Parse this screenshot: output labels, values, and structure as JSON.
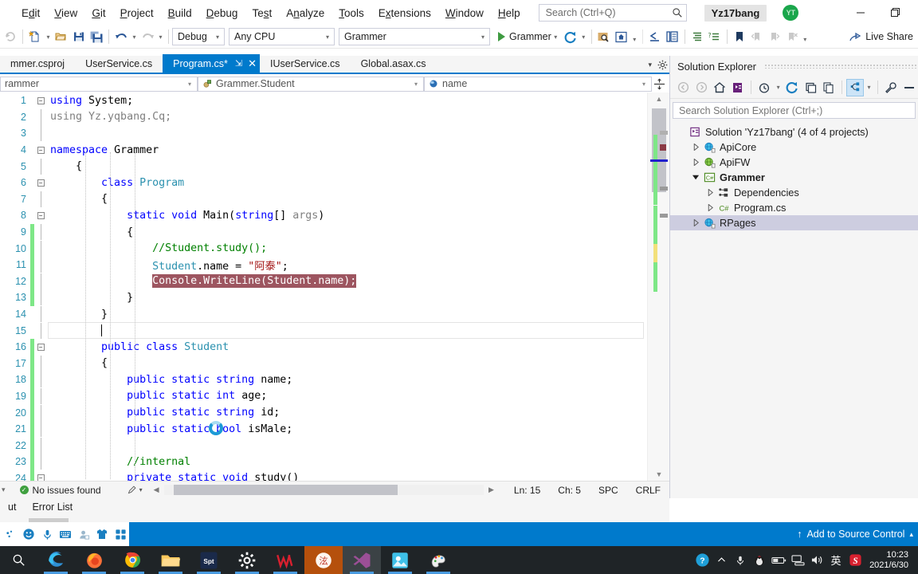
{
  "menubar": {
    "items": [
      {
        "label": "Edit",
        "accel": "d"
      },
      {
        "label": "View",
        "accel": "V"
      },
      {
        "label": "Git",
        "accel": "G"
      },
      {
        "label": "Project",
        "accel": "P"
      },
      {
        "label": "Build",
        "accel": "B"
      },
      {
        "label": "Debug",
        "accel": "D"
      },
      {
        "label": "Test",
        "accel": "s"
      },
      {
        "label": "Analyze",
        "accel": "n"
      },
      {
        "label": "Tools",
        "accel": "T"
      },
      {
        "label": "Extensions",
        "accel": "x"
      },
      {
        "label": "Window",
        "accel": "W"
      },
      {
        "label": "Help",
        "accel": "H"
      }
    ],
    "search_placeholder": "Search (Ctrl+Q)",
    "account_name": "Yz17bang",
    "avatar_initials": "YT",
    "minimize_label": "Minimize",
    "restore_label": "Restore"
  },
  "toolbar": {
    "config_combo": "Debug",
    "platform_combo": "Any CPU",
    "startup_combo": "Grammer",
    "run_label": "Grammer",
    "live_share_label": "Live Share",
    "icons": [
      "navigate-back-icon",
      "new-file-icon",
      "open-file-icon",
      "save-icon",
      "save-all-icon",
      "undo-icon",
      "redo-icon"
    ]
  },
  "tabs": {
    "items": [
      {
        "label": "mmer.csproj",
        "active": false
      },
      {
        "label": "UserService.cs",
        "active": false
      },
      {
        "label": "Program.cs*",
        "active": true
      },
      {
        "label": "IUserService.cs",
        "active": false
      },
      {
        "label": "Global.asax.cs",
        "active": false
      }
    ],
    "pin_glyph": "⇲",
    "close_glyph": "✕"
  },
  "navbar": {
    "project_combo": "rammer",
    "type_combo": "Grammer.Student",
    "member_combo": "name"
  },
  "editor": {
    "lines": [
      {
        "n": 1,
        "fold": "minus",
        "change": "",
        "indent": 0,
        "tokens": [
          {
            "t": "using ",
            "c": "k"
          },
          {
            "t": "System;",
            "c": "pl"
          }
        ]
      },
      {
        "n": 2,
        "fold": "",
        "change": "",
        "indent": 0,
        "tokens": [
          {
            "t": "using Yz.yqbang.Cq;",
            "c": "gy"
          }
        ]
      },
      {
        "n": 3,
        "fold": "",
        "change": "",
        "indent": 0,
        "tokens": []
      },
      {
        "n": 4,
        "fold": "minus",
        "change": "",
        "indent": 0,
        "tokens": [
          {
            "t": "namespace ",
            "c": "k"
          },
          {
            "t": "Grammer",
            "c": "pl"
          }
        ]
      },
      {
        "n": 5,
        "fold": "",
        "change": "",
        "indent": 1,
        "tokens": [
          {
            "t": "{",
            "c": "pl"
          }
        ]
      },
      {
        "n": 6,
        "fold": "minus",
        "change": "",
        "indent": 2,
        "tokens": [
          {
            "t": "class ",
            "c": "k"
          },
          {
            "t": "Program",
            "c": "ty"
          }
        ]
      },
      {
        "n": 7,
        "fold": "",
        "change": "",
        "indent": 2,
        "tokens": [
          {
            "t": "{",
            "c": "pl"
          }
        ]
      },
      {
        "n": 8,
        "fold": "minus",
        "change": "",
        "indent": 3,
        "tokens": [
          {
            "t": "static void ",
            "c": "k"
          },
          {
            "t": "Main(",
            "c": "pl"
          },
          {
            "t": "string",
            "c": "k"
          },
          {
            "t": "[] ",
            "c": "pl"
          },
          {
            "t": "args",
            "c": "pr"
          },
          {
            "t": ")",
            "c": "pl"
          }
        ]
      },
      {
        "n": 9,
        "fold": "",
        "change": "green",
        "indent": 3,
        "tokens": [
          {
            "t": "{",
            "c": "pl"
          }
        ]
      },
      {
        "n": 10,
        "fold": "",
        "change": "green",
        "indent": 4,
        "tokens": [
          {
            "t": "//Student.study();",
            "c": "cm"
          }
        ]
      },
      {
        "n": 11,
        "fold": "",
        "change": "green",
        "indent": 4,
        "tokens": [
          {
            "t": "Student",
            "c": "ty"
          },
          {
            "t": ".name = ",
            "c": "pl"
          },
          {
            "t": "\"阿泰\"",
            "c": "st"
          },
          {
            "t": ";",
            "c": "pl"
          }
        ]
      },
      {
        "n": 12,
        "fold": "",
        "change": "green",
        "indent": 4,
        "selected": true,
        "tokens": [
          {
            "t": "Console.WriteLine(Student.name);",
            "c": "pl"
          }
        ]
      },
      {
        "n": 13,
        "fold": "",
        "change": "green",
        "indent": 3,
        "tokens": [
          {
            "t": "}",
            "c": "pl"
          }
        ]
      },
      {
        "n": 14,
        "fold": "",
        "change": "",
        "indent": 2,
        "tokens": [
          {
            "t": "}",
            "c": "pl"
          }
        ]
      },
      {
        "n": 15,
        "fold": "",
        "change": "",
        "indent": 2,
        "current": true,
        "tokens": []
      },
      {
        "n": 16,
        "fold": "minus",
        "change": "green",
        "indent": 2,
        "tokens": [
          {
            "t": "public class ",
            "c": "k"
          },
          {
            "t": "Student",
            "c": "ty"
          }
        ]
      },
      {
        "n": 17,
        "fold": "",
        "change": "green",
        "indent": 2,
        "tokens": [
          {
            "t": "{",
            "c": "pl"
          }
        ]
      },
      {
        "n": 18,
        "fold": "",
        "change": "green",
        "indent": 3,
        "tokens": [
          {
            "t": "public static string ",
            "c": "k"
          },
          {
            "t": "name;",
            "c": "pl"
          }
        ]
      },
      {
        "n": 19,
        "fold": "",
        "change": "green",
        "indent": 3,
        "tokens": [
          {
            "t": "public static int ",
            "c": "k"
          },
          {
            "t": "age;",
            "c": "pl"
          }
        ]
      },
      {
        "n": 20,
        "fold": "",
        "change": "green",
        "indent": 3,
        "tokens": [
          {
            "t": "public static string ",
            "c": "k"
          },
          {
            "t": "id;",
            "c": "pl"
          }
        ]
      },
      {
        "n": 21,
        "fold": "",
        "change": "green",
        "indent": 3,
        "tokens": [
          {
            "t": "public static bool ",
            "c": "k"
          },
          {
            "t": "isMale;",
            "c": "pl"
          }
        ]
      },
      {
        "n": 22,
        "fold": "",
        "change": "green",
        "indent": 3,
        "tokens": []
      },
      {
        "n": 23,
        "fold": "",
        "change": "green",
        "indent": 3,
        "tokens": [
          {
            "t": "//internal",
            "c": "cm"
          }
        ]
      },
      {
        "n": 24,
        "fold": "minus",
        "change": "green",
        "indent": 3,
        "tokens": [
          {
            "t": "private static void ",
            "c": "k"
          },
          {
            "t": "study()",
            "c": "pl"
          }
        ]
      }
    ]
  },
  "editor_status": {
    "issues": "No issues found",
    "line": "Ln: 15",
    "col": "Ch: 5",
    "spaces": "SPC",
    "eol": "CRLF"
  },
  "solution_explorer": {
    "title": "Solution Explorer",
    "search_placeholder": "Search Solution Explorer (Ctrl+;)",
    "toolbar_icons": [
      "back-icon",
      "forward-icon",
      "home-icon",
      "pending-changes-icon",
      "history-icon",
      "refresh-icon",
      "collapse-all-icon",
      "show-all-files-icon",
      "solution-view-icon",
      "properties-icon",
      "preview-icon"
    ],
    "tree": [
      {
        "label": "Solution 'Yz17bang' (4 of 4 projects)",
        "depth": 0,
        "arrow": "",
        "icon": "solution-icon",
        "bold": false,
        "selected": false
      },
      {
        "label": "ApiCore",
        "depth": 1,
        "arrow": "collapsed",
        "icon": "web-project-icon",
        "bold": false,
        "selected": false
      },
      {
        "label": "ApiFW",
        "depth": 1,
        "arrow": "collapsed",
        "icon": "web-project-green-icon",
        "bold": false,
        "selected": false
      },
      {
        "label": "Grammer",
        "depth": 1,
        "arrow": "expanded",
        "icon": "csharp-project-icon",
        "bold": true,
        "selected": false
      },
      {
        "label": "Dependencies",
        "depth": 2,
        "arrow": "collapsed",
        "icon": "dependencies-icon",
        "bold": false,
        "selected": false
      },
      {
        "label": "Program.cs",
        "depth": 2,
        "arrow": "collapsed",
        "icon": "csharp-file-icon",
        "bold": false,
        "selected": false
      },
      {
        "label": "RPages",
        "depth": 1,
        "arrow": "collapsed",
        "icon": "web-project-icon",
        "bold": false,
        "selected": true
      }
    ]
  },
  "bottom_panel": {
    "tabs": [
      {
        "label": "ut"
      },
      {
        "label": "Error List"
      }
    ]
  },
  "ime_bar": {
    "icons": [
      "ink-icon",
      "emoji-icon",
      "microphone-icon",
      "touch-keyboard-icon",
      "contacts-icon",
      "shirt-icon",
      "apps-icon"
    ]
  },
  "vs_status": {
    "source_control_label": "Add to Source Control",
    "up_arrow": "↑"
  },
  "taskbar": {
    "apps": [
      {
        "name": "search-icon",
        "state": ""
      },
      {
        "name": "edge-icon",
        "state": "open"
      },
      {
        "name": "firefox-icon",
        "state": "open"
      },
      {
        "name": "chrome-icon",
        "state": "open"
      },
      {
        "name": "file-explorer-icon",
        "state": "open"
      },
      {
        "name": "spotify-icon",
        "state": "open"
      },
      {
        "name": "settings-icon",
        "state": "open"
      },
      {
        "name": "wps-icon",
        "state": "open"
      },
      {
        "name": "yq-app-icon",
        "state": "active"
      },
      {
        "name": "visual-studio-icon",
        "state": "active2"
      },
      {
        "name": "photos-icon",
        "state": "open"
      },
      {
        "name": "paint-icon",
        "state": "open"
      }
    ],
    "tray": [
      "network-help-icon",
      "chevron-up-icon",
      "microphone-icon",
      "qq-icon",
      "battery-icon",
      "network-icon",
      "volume-icon",
      "ime-cn-icon",
      "sogou-icon"
    ],
    "time": "10:23",
    "date": "2021/6/30"
  },
  "colors": {
    "accent": "#007acc",
    "selection": "#9d5560",
    "change_bar": "#7ee787",
    "taskbar": "#1f2427",
    "active_task": "#b5500c"
  }
}
